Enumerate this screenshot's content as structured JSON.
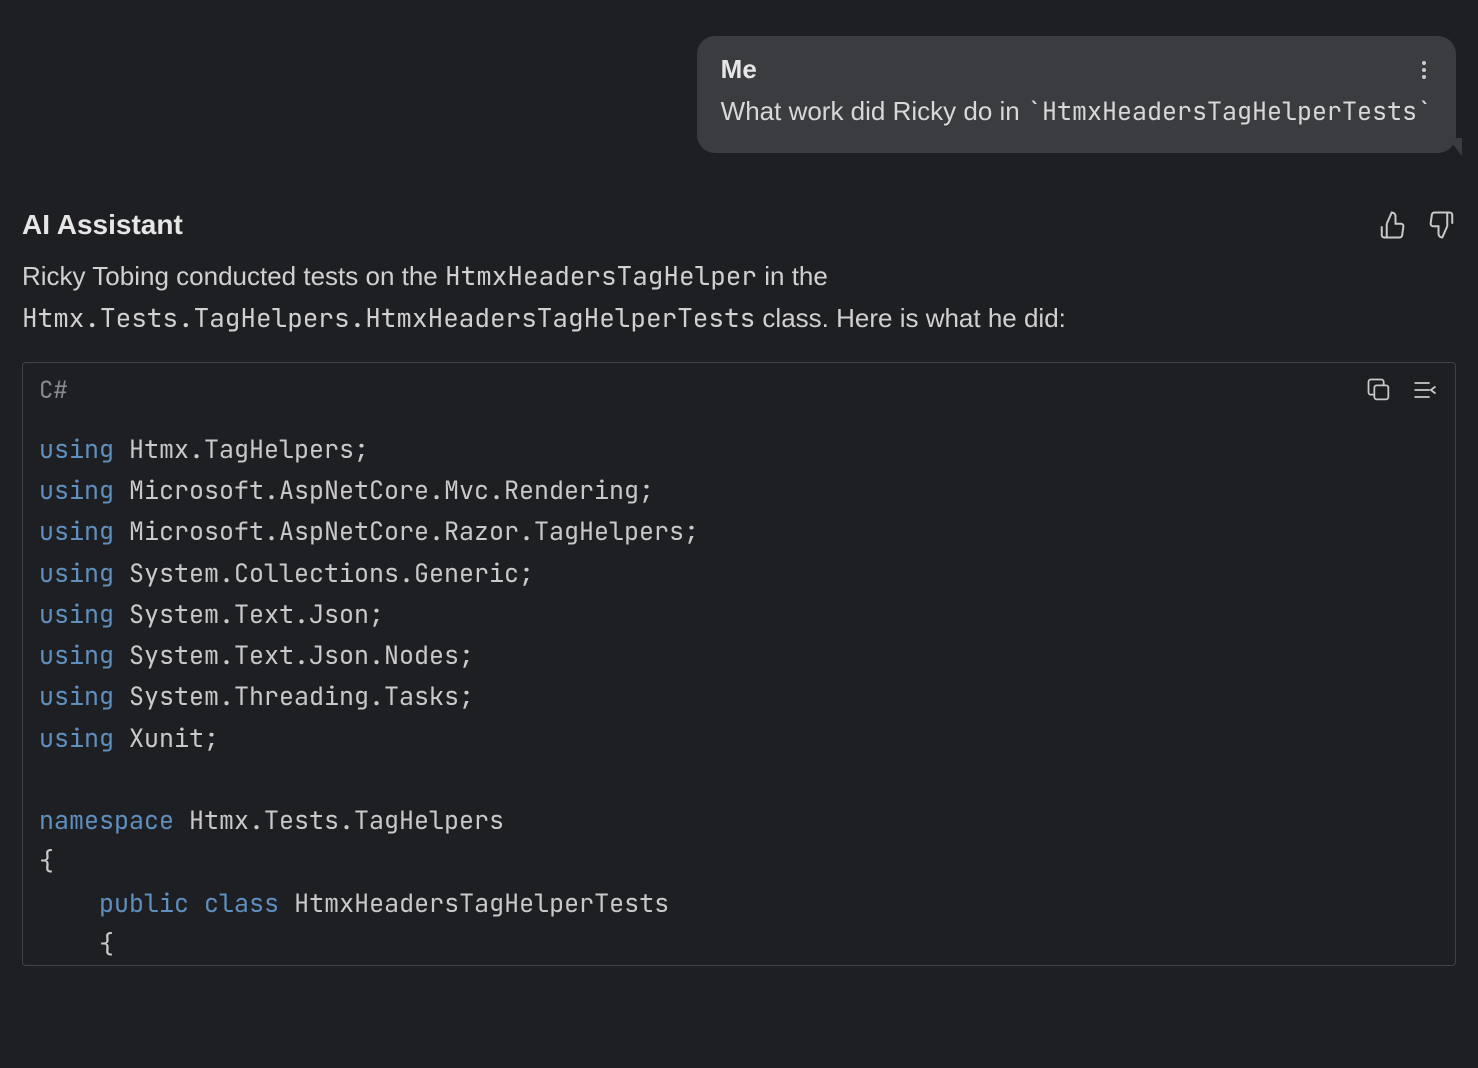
{
  "user_message": {
    "sender": "Me",
    "text_prefix": "What work did Ricky do in ",
    "code_span": "`HtmxHeadersTagHelperTests`"
  },
  "assistant": {
    "name": "AI Assistant",
    "response": {
      "line1_part1": "Ricky Tobing conducted tests on the ",
      "line1_code1": "HtmxHeadersTagHelper",
      "line1_part2": " in the ",
      "line2_code": "Htmx.Tests.TagHelpers.HtmxHeadersTagHelperTests",
      "line2_part2": " class. Here is what he did:"
    }
  },
  "code_block": {
    "language": "C#",
    "tokens": [
      {
        "t": "kw",
        "v": "using"
      },
      {
        "t": "txt",
        "v": " Htmx.TagHelpers;\n"
      },
      {
        "t": "kw",
        "v": "using"
      },
      {
        "t": "txt",
        "v": " Microsoft.AspNetCore.Mvc.Rendering;\n"
      },
      {
        "t": "kw",
        "v": "using"
      },
      {
        "t": "txt",
        "v": " Microsoft.AspNetCore.Razor.TagHelpers;\n"
      },
      {
        "t": "kw",
        "v": "using"
      },
      {
        "t": "txt",
        "v": " System.Collections.Generic;\n"
      },
      {
        "t": "kw",
        "v": "using"
      },
      {
        "t": "txt",
        "v": " System.Text.Json;\n"
      },
      {
        "t": "kw",
        "v": "using"
      },
      {
        "t": "txt",
        "v": " System.Text.Json.Nodes;\n"
      },
      {
        "t": "kw",
        "v": "using"
      },
      {
        "t": "txt",
        "v": " System.Threading.Tasks;\n"
      },
      {
        "t": "kw",
        "v": "using"
      },
      {
        "t": "txt",
        "v": " Xunit;\n"
      },
      {
        "t": "txt",
        "v": "\n"
      },
      {
        "t": "kw",
        "v": "namespace"
      },
      {
        "t": "txt",
        "v": " Htmx.Tests.TagHelpers\n"
      },
      {
        "t": "txt",
        "v": "{\n"
      },
      {
        "t": "txt",
        "v": "    "
      },
      {
        "t": "kw",
        "v": "public"
      },
      {
        "t": "txt",
        "v": " "
      },
      {
        "t": "kw",
        "v": "class"
      },
      {
        "t": "txt",
        "v": " HtmxHeadersTagHelperTests\n"
      },
      {
        "t": "txt",
        "v": "    {\n"
      }
    ]
  }
}
